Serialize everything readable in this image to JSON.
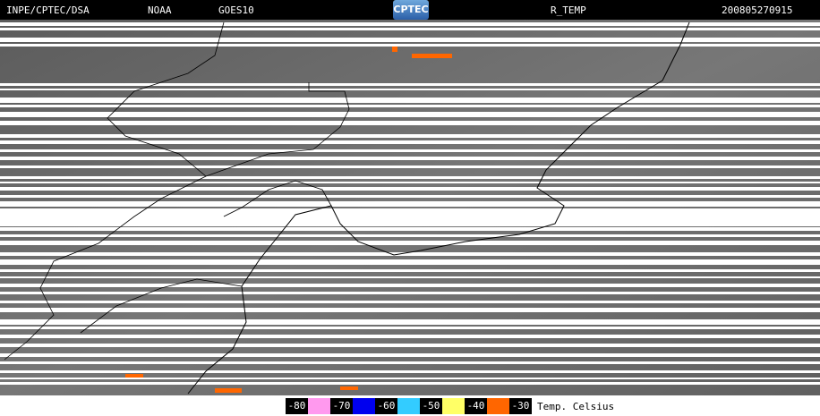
{
  "header": {
    "org": "INPE/CPTEC/DSA",
    "agency": "NOAA",
    "satellite": "GOES10",
    "logo_text": "CPTEC",
    "product": "R_TEMP",
    "timestamp": "200805270915"
  },
  "legend": {
    "title": "Temp. Celsius",
    "items": [
      {
        "label": "-80",
        "color": "#ff99ee"
      },
      {
        "label": "-70",
        "color": "#0000ee"
      },
      {
        "label": "-60",
        "color": "#33ccff"
      },
      {
        "label": "-50",
        "color": "#ffff66"
      },
      {
        "label": "-40",
        "color": "#ff6600"
      },
      {
        "label": "-30",
        "color": ""
      }
    ]
  }
}
